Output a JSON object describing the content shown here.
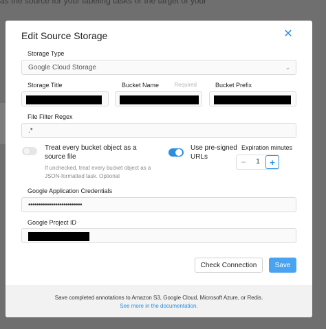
{
  "background": {
    "text": "as the source for your labeling tasks or the target of your"
  },
  "modal": {
    "title": "Edit Source Storage",
    "close_icon": "close-icon"
  },
  "form": {
    "storage_type": {
      "label": "Storage Type",
      "value": "Google Cloud Storage",
      "icon": "chevron-down-icon"
    },
    "storage_title": {
      "label": "Storage Title",
      "redacted": true
    },
    "bucket_name": {
      "label": "Bucket Name",
      "required": "Required",
      "redacted": true
    },
    "bucket_prefix": {
      "label": "Bucket Prefix",
      "redacted": true
    },
    "file_filter": {
      "label": "File Filter Regex",
      "value": ".*"
    },
    "treat_objects": {
      "label": "Treat every bucket object as a source file",
      "enabled": false,
      "hint": "If unchecked, treat every bucket object as a JSON-formatted task. Optional"
    },
    "presigned": {
      "label": "Use pre-signed URLs",
      "enabled": true
    },
    "expiration": {
      "label": "Expiration minutes",
      "value": "1",
      "minus": "−",
      "plus": "+"
    },
    "credentials": {
      "label": "Google Application Credentials",
      "value": "••••••••••••••••••••••••••"
    },
    "project_id": {
      "label": "Google Project ID",
      "redacted": true
    }
  },
  "actions": {
    "check_label": "Check Connection",
    "save_label": "Save"
  },
  "footer": {
    "text": "Save completed annotations to Amazon S3, Google Cloud, Microsoft Azure, or Redis.",
    "link": "See more in the documentation."
  },
  "colors": {
    "accent": "#2a8fe0",
    "primary_button": "#4aa3f0"
  }
}
